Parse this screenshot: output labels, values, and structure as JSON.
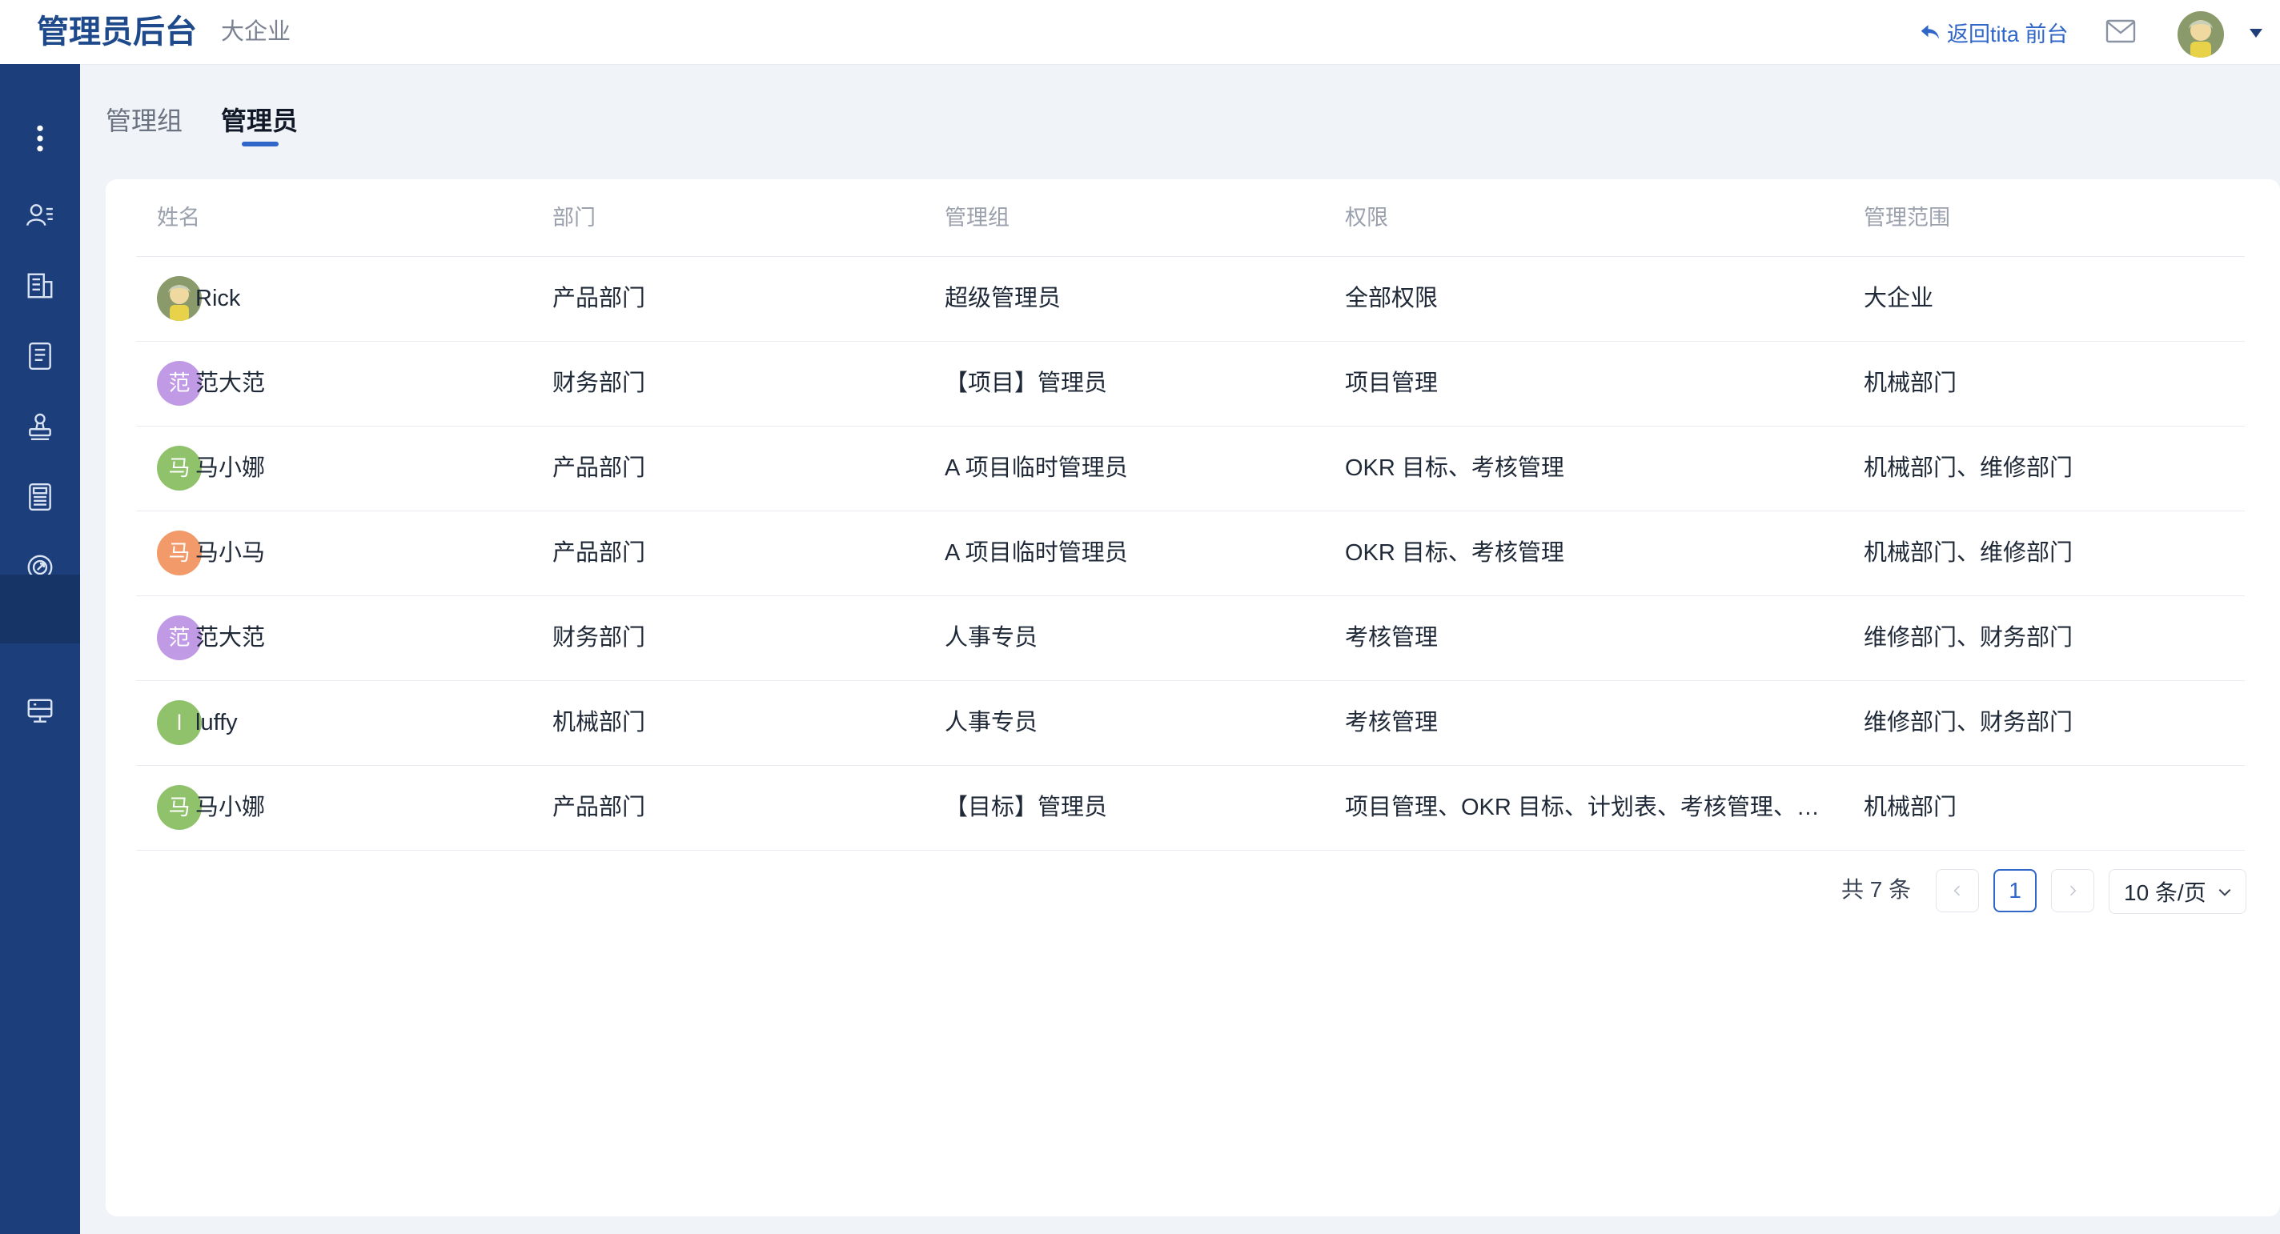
{
  "header": {
    "app_title": "管理员后台",
    "org_name": "大企业",
    "back_link": "返回tita 前台",
    "icons": [
      "reply-arrow-icon",
      "mail-icon",
      "user-avatar",
      "caret-down-icon"
    ]
  },
  "sidebar": {
    "items": [
      {
        "icon": "more-vertical-icon"
      },
      {
        "icon": "users-list-icon"
      },
      {
        "icon": "building-icon"
      },
      {
        "icon": "document-icon"
      },
      {
        "icon": "stamp-icon"
      },
      {
        "icon": "news-icon"
      },
      {
        "icon": "target-icon"
      },
      {
        "icon": "admin-active-blank",
        "active": true
      },
      {
        "icon": "monitor-icon"
      }
    ],
    "colors": {
      "bg": "#1c3f7c",
      "active": "#173466"
    }
  },
  "tabs": [
    {
      "label": "管理组",
      "active": false
    },
    {
      "label": "管理员",
      "active": true
    }
  ],
  "table": {
    "columns": [
      "姓名",
      "部门",
      "管理组",
      "权限",
      "管理范围"
    ],
    "rows": [
      {
        "avatar_text": "",
        "avatar_color": "photo",
        "name": "Rick",
        "dept": "产品部门",
        "group": "超级管理员",
        "perm": "全部权限",
        "scope": "大企业"
      },
      {
        "avatar_text": "范",
        "avatar_color": "#c19ae6",
        "name": "范大范",
        "dept": "财务部门",
        "group": "【项目】管理员",
        "perm": "项目管理",
        "scope": "机械部门"
      },
      {
        "avatar_text": "马",
        "avatar_color": "#8fc26b",
        "name": "马小娜",
        "dept": "产品部门",
        "group": "A 项目临时管理员",
        "perm": "OKR 目标、考核管理",
        "scope": "机械部门、维修部门"
      },
      {
        "avatar_text": "马",
        "avatar_color": "#f29a6a",
        "name": "马小马",
        "dept": "产品部门",
        "group": "A 项目临时管理员",
        "perm": "OKR 目标、考核管理",
        "scope": "机械部门、维修部门"
      },
      {
        "avatar_text": "范",
        "avatar_color": "#c19ae6",
        "name": "范大范",
        "dept": "财务部门",
        "group": "人事专员",
        "perm": "考核管理",
        "scope": "维修部门、财务部门"
      },
      {
        "avatar_text": "l",
        "avatar_color": "#8fc26b",
        "name": "luffy",
        "dept": "机械部门",
        "group": "人事专员",
        "perm": "考核管理",
        "scope": "维修部门、财务部门"
      },
      {
        "avatar_text": "马",
        "avatar_color": "#8fc26b",
        "name": "马小娜",
        "dept": "产品部门",
        "group": "【目标】管理员",
        "perm": "项目管理、OKR 目标、计划表、考核管理、…",
        "scope": "机械部门"
      }
    ]
  },
  "pagination": {
    "total": "共 7 条",
    "current_page": "1",
    "page_size": "10 条/页"
  },
  "colors": {
    "accent": "#2f66c8",
    "title": "#1e4a8c"
  }
}
